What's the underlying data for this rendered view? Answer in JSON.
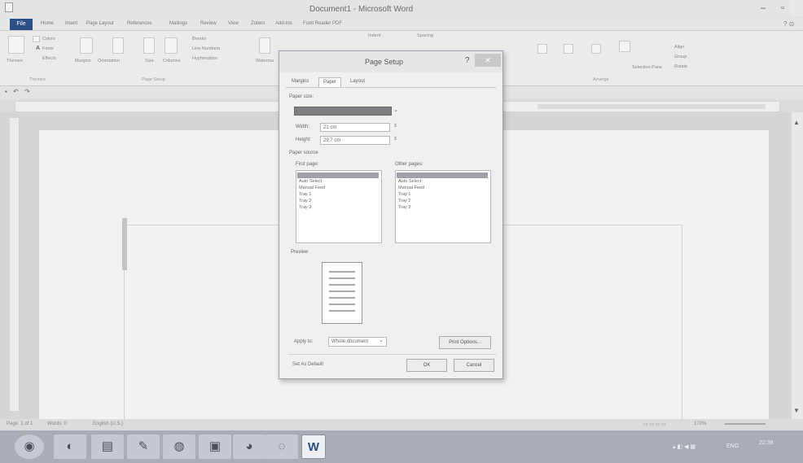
{
  "window": {
    "title": "Document1 - Microsoft Word",
    "minimize": "–",
    "maximize": "▫"
  },
  "ribbon": {
    "file_tab": "File",
    "tabs": [
      "Home",
      "Insert",
      "Page Layout",
      "References",
      "Mailings",
      "Review",
      "View",
      "Zotero",
      "Add-Ins",
      "Foxit Reader PDF"
    ],
    "buttons": {
      "themes": "Themes",
      "colors": "Colors",
      "fonts": "Fonts",
      "effects": "Effects",
      "margins": "Margins",
      "orientation": "Orientation",
      "size": "Size",
      "columns": "Columns",
      "breaks": "Breaks",
      "line_numbers": "Line Numbers",
      "hyphenation": "Hyphenation",
      "watermark": "Waterma",
      "indent": "Indent",
      "spacing": "Spacing",
      "selection_pane": "Selection Pane",
      "align": "Align",
      "group": "Group",
      "rotate": "Rotate"
    },
    "groups": {
      "themes": "Themes",
      "page_setup": "Page Setup",
      "arrange": "Arrange"
    }
  },
  "status": {
    "page": "Page: 1 of 1",
    "words": "Words: 0",
    "language": "English (U.S.)",
    "zoom": "170%"
  },
  "taskbar": {
    "tray_lang": "ENG",
    "time": "22:38"
  },
  "dialog": {
    "title": "Page Setup",
    "help": "?",
    "close": "✕",
    "tabs": [
      "Margins",
      "Paper",
      "Layout"
    ],
    "paper_size_label": "Paper size:",
    "width_label": "Width:",
    "width_value": "21 cm",
    "height_label": "Height:",
    "height_value": "29.7 cm",
    "paper_source_label": "Paper source",
    "first_page_label": "First page:",
    "other_pages_label": "Other pages:",
    "source_options": [
      "Auto Select",
      "Manual Feed",
      "Tray 1",
      "Tray 2",
      "Tray 3"
    ],
    "preview_label": "Preview",
    "apply_to_label": "Apply to:",
    "apply_to_value": "Whole document",
    "print_options": "Print Options...",
    "set_default": "Set As Default",
    "ok": "OK",
    "cancel": "Cancel"
  }
}
